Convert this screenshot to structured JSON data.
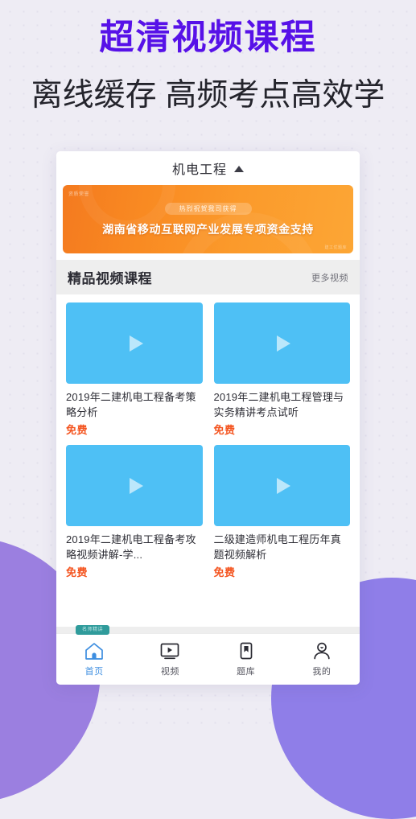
{
  "promo": {
    "title_main": "超清视频课程",
    "title_sub": "离线缓存 高频考点高效学",
    "color_title": "#5711e8"
  },
  "app": {
    "header": {
      "title": "机电工程",
      "caret_icon": "caret-up-icon"
    },
    "banner": {
      "corner_label": "资质荣誉",
      "pill_text": "热烈祝贺我司获得",
      "main_text": "湖南省移动互联网产业发展专项资金支持",
      "brand_mark": "建工优题库",
      "bg_color": "#f8881f"
    },
    "section": {
      "title": "精品视频课程",
      "more_label": "更多视频"
    },
    "courses": [
      {
        "title": "2019年二建机电工程备考策略分析",
        "price": "免费",
        "thumb_color": "#4ec0f5",
        "play_icon": "play-icon"
      },
      {
        "title": "2019年二建机电工程管理与实务精讲考点试听",
        "price": "免费",
        "thumb_color": "#4ec0f5",
        "play_icon": "play-icon"
      },
      {
        "title": "2019年二建机电工程备考攻略视频讲解-学...",
        "price": "免费",
        "thumb_color": "#4ec0f5",
        "play_icon": "play-icon"
      },
      {
        "title": "二级建造师机电工程历年真题视频解析",
        "price": "免费",
        "thumb_color": "#4ec0f5",
        "play_icon": "play-icon"
      }
    ],
    "tabbar": {
      "badge_text": "名师精讲",
      "items": [
        {
          "label": "首页",
          "icon": "home-icon",
          "active": true
        },
        {
          "label": "视频",
          "icon": "video-icon",
          "active": false
        },
        {
          "label": "题库",
          "icon": "bookmark-icon",
          "active": false
        },
        {
          "label": "我的",
          "icon": "user-icon",
          "active": false
        }
      ]
    }
  }
}
